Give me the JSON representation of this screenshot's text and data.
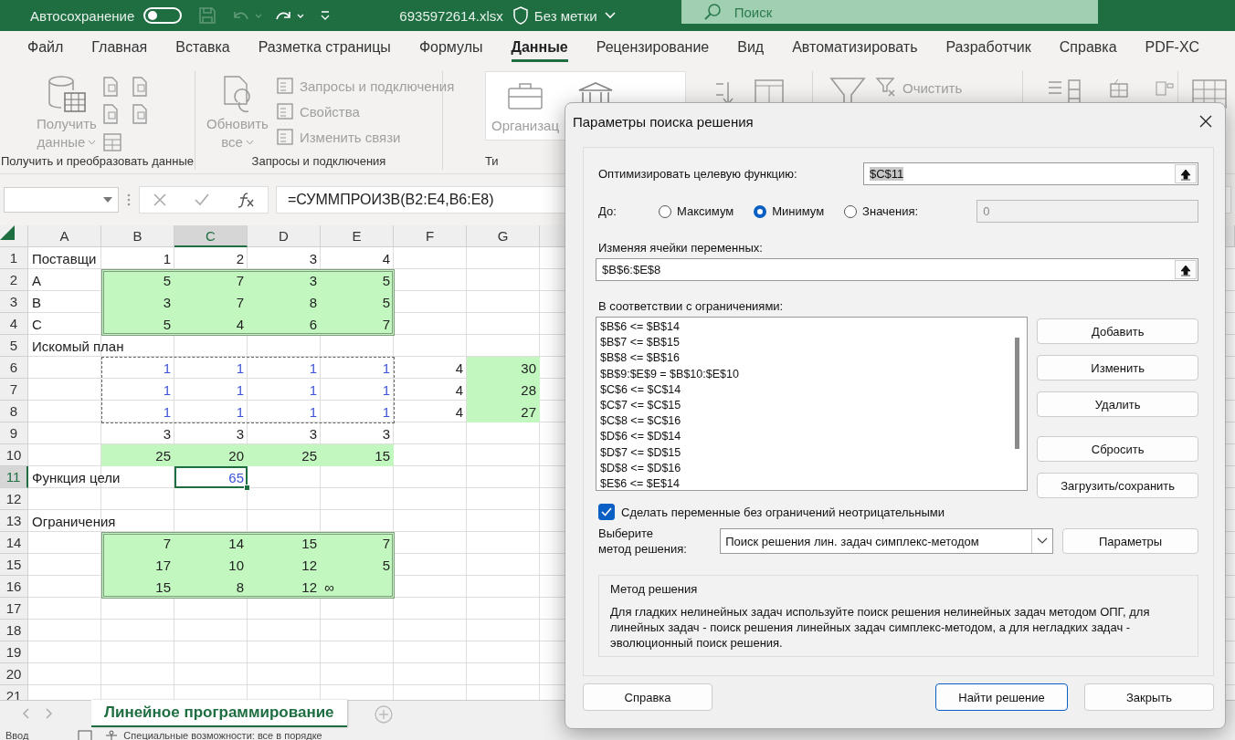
{
  "titlebar": {
    "autosave_label": "Автосохранение",
    "autosave_on": false,
    "filename": "6935972614.xlsx",
    "sensitivity": "Без метки",
    "search_placeholder": "Поиск"
  },
  "menu_tabs": [
    {
      "label": "Файл",
      "selected": false
    },
    {
      "label": "Главная",
      "selected": false
    },
    {
      "label": "Вставка",
      "selected": false
    },
    {
      "label": "Разметка страницы",
      "selected": false
    },
    {
      "label": "Формулы",
      "selected": false
    },
    {
      "label": "Данные",
      "selected": true
    },
    {
      "label": "Рецензирование",
      "selected": false
    },
    {
      "label": "Вид",
      "selected": false
    },
    {
      "label": "Автоматизировать",
      "selected": false
    },
    {
      "label": "Разработчик",
      "selected": false
    },
    {
      "label": "Справка",
      "selected": false
    },
    {
      "label": "PDF-XC",
      "selected": false
    }
  ],
  "ribbon": {
    "get_data": {
      "label": "Получить и преобразовать данные",
      "button_lines": [
        "Получить",
        "данные"
      ],
      "disabled": true
    },
    "queries": {
      "label": "Запросы и подключения",
      "button_lines": [
        "Обновить",
        "все"
      ],
      "disabled": true,
      "small": [
        {
          "label": "Запросы и подключения",
          "disabled": true
        },
        {
          "label": "Свойства",
          "disabled": true
        },
        {
          "label": "Изменить связи",
          "disabled": true
        }
      ]
    },
    "types": {
      "label": "Ти",
      "item": "Организац"
    },
    "filter": {
      "clear": "Очистить",
      "disabled": true
    }
  },
  "formula_bar": {
    "formula": "=СУММПРОИЗВ(B2:E4,B6:E8)"
  },
  "grid": {
    "columns": [
      {
        "label": "A",
        "selected": false
      },
      {
        "label": "B",
        "selected": false
      },
      {
        "label": "C",
        "selected": true
      },
      {
        "label": "D",
        "selected": false
      },
      {
        "label": "E",
        "selected": false
      },
      {
        "label": "F",
        "selected": false
      },
      {
        "label": "G",
        "selected": false
      }
    ],
    "rows": [
      {
        "label": "1",
        "selected": false,
        "cells": [
          {
            "text": "Поставщи",
            "kind": "label",
            "filled": false,
            "selected": false
          },
          {
            "text": "1",
            "kind": "number",
            "filled": false,
            "selected": false
          },
          {
            "text": "2",
            "kind": "number",
            "filled": false,
            "selected": false
          },
          {
            "text": "3",
            "kind": "number",
            "filled": false,
            "selected": false
          },
          {
            "text": "4",
            "kind": "number",
            "filled": false,
            "selected": false
          }
        ]
      },
      {
        "label": "2",
        "selected": false,
        "cells": [
          {
            "text": "A",
            "kind": "label",
            "filled": false,
            "selected": false
          },
          {
            "text": "5",
            "kind": "number",
            "filled": true,
            "selected": false
          },
          {
            "text": "7",
            "kind": "number",
            "filled": true,
            "selected": false
          },
          {
            "text": "3",
            "kind": "number",
            "filled": true,
            "selected": false
          },
          {
            "text": "5",
            "kind": "number",
            "filled": true,
            "selected": false
          }
        ]
      },
      {
        "label": "3",
        "selected": false,
        "cells": [
          {
            "text": "B",
            "kind": "label",
            "filled": false,
            "selected": false
          },
          {
            "text": "3",
            "kind": "number",
            "filled": true,
            "selected": false
          },
          {
            "text": "7",
            "kind": "number",
            "filled": true,
            "selected": false
          },
          {
            "text": "8",
            "kind": "number",
            "filled": true,
            "selected": false
          },
          {
            "text": "5",
            "kind": "number",
            "filled": true,
            "selected": false
          }
        ]
      },
      {
        "label": "4",
        "selected": false,
        "cells": [
          {
            "text": "C",
            "kind": "label",
            "filled": false,
            "selected": false
          },
          {
            "text": "5",
            "kind": "number",
            "filled": true,
            "selected": false
          },
          {
            "text": "4",
            "kind": "number",
            "filled": true,
            "selected": false
          },
          {
            "text": "6",
            "kind": "number",
            "filled": true,
            "selected": false
          },
          {
            "text": "7",
            "kind": "number",
            "filled": true,
            "selected": false
          }
        ]
      },
      {
        "label": "5",
        "selected": false,
        "cells": [
          {
            "text": "Искомый план",
            "kind": "label",
            "filled": false,
            "selected": false
          }
        ]
      },
      {
        "label": "6",
        "selected": false,
        "cells": [
          null,
          {
            "text": "1",
            "kind": "variable",
            "filled": false,
            "selected": false
          },
          {
            "text": "1",
            "kind": "variable",
            "filled": false,
            "selected": false
          },
          {
            "text": "1",
            "kind": "variable",
            "filled": false,
            "selected": false
          },
          {
            "text": "1",
            "kind": "variable",
            "filled": false,
            "selected": false
          },
          {
            "text": "4",
            "kind": "number",
            "filled": false,
            "selected": false
          },
          {
            "text": "30",
            "kind": "number",
            "filled": true,
            "selected": false
          }
        ]
      },
      {
        "label": "7",
        "selected": false,
        "cells": [
          null,
          {
            "text": "1",
            "kind": "variable",
            "filled": false,
            "selected": false
          },
          {
            "text": "1",
            "kind": "variable",
            "filled": false,
            "selected": false
          },
          {
            "text": "1",
            "kind": "variable",
            "filled": false,
            "selected": false
          },
          {
            "text": "1",
            "kind": "variable",
            "filled": false,
            "selected": false
          },
          {
            "text": "4",
            "kind": "number",
            "filled": false,
            "selected": false
          },
          {
            "text": "28",
            "kind": "number",
            "filled": true,
            "selected": false
          }
        ]
      },
      {
        "label": "8",
        "selected": false,
        "cells": [
          null,
          {
            "text": "1",
            "kind": "variable",
            "filled": false,
            "selected": false
          },
          {
            "text": "1",
            "kind": "variable",
            "filled": false,
            "selected": false
          },
          {
            "text": "1",
            "kind": "variable",
            "filled": false,
            "selected": false
          },
          {
            "text": "1",
            "kind": "variable",
            "filled": false,
            "selected": false
          },
          {
            "text": "4",
            "kind": "number",
            "filled": false,
            "selected": false
          },
          {
            "text": "27",
            "kind": "number",
            "filled": true,
            "selected": false
          }
        ]
      },
      {
        "label": "9",
        "selected": false,
        "cells": [
          null,
          {
            "text": "3",
            "kind": "number",
            "filled": false,
            "selected": false
          },
          {
            "text": "3",
            "kind": "number",
            "filled": false,
            "selected": false
          },
          {
            "text": "3",
            "kind": "number",
            "filled": false,
            "selected": false
          },
          {
            "text": "3",
            "kind": "number",
            "filled": false,
            "selected": false
          }
        ]
      },
      {
        "label": "10",
        "selected": false,
        "cells": [
          null,
          {
            "text": "25",
            "kind": "number",
            "filled": true,
            "selected": false
          },
          {
            "text": "20",
            "kind": "number",
            "filled": true,
            "selected": false
          },
          {
            "text": "25",
            "kind": "number",
            "filled": true,
            "selected": false
          },
          {
            "text": "15",
            "kind": "number",
            "filled": true,
            "selected": false
          }
        ]
      },
      {
        "label": "11",
        "selected": true,
        "cells": [
          {
            "text": "Функция цели",
            "kind": "label",
            "filled": false,
            "selected": false
          },
          null,
          {
            "text": "65",
            "kind": "variable",
            "filled": false,
            "selected": true
          }
        ]
      },
      {
        "label": "12",
        "selected": false,
        "cells": []
      },
      {
        "label": "13",
        "selected": false,
        "cells": [
          {
            "text": "Ограничения",
            "kind": "label",
            "filled": false,
            "selected": false
          }
        ]
      },
      {
        "label": "14",
        "selected": false,
        "cells": [
          null,
          {
            "text": "7",
            "kind": "number",
            "filled": true,
            "selected": false
          },
          {
            "text": "14",
            "kind": "number",
            "filled": true,
            "selected": false
          },
          {
            "text": "15",
            "kind": "number",
            "filled": true,
            "selected": false
          },
          {
            "text": "7",
            "kind": "number",
            "filled": true,
            "selected": false
          }
        ]
      },
      {
        "label": "15",
        "selected": false,
        "cells": [
          null,
          {
            "text": "17",
            "kind": "number",
            "filled": true,
            "selected": false
          },
          {
            "text": "10",
            "kind": "number",
            "filled": true,
            "selected": false
          },
          {
            "text": "12",
            "kind": "number",
            "filled": true,
            "selected": false
          },
          {
            "text": "5",
            "kind": "number",
            "filled": true,
            "selected": false
          }
        ]
      },
      {
        "label": "16",
        "selected": false,
        "cells": [
          null,
          {
            "text": "15",
            "kind": "number",
            "filled": true,
            "selected": false
          },
          {
            "text": "8",
            "kind": "number",
            "filled": true,
            "selected": false
          },
          {
            "text": "12",
            "kind": "number",
            "filled": true,
            "selected": false
          },
          {
            "text": "∞",
            "kind": "label",
            "filled": true,
            "selected": false
          }
        ]
      },
      {
        "label": "17",
        "selected": false,
        "cells": []
      },
      {
        "label": "18",
        "selected": false,
        "cells": []
      },
      {
        "label": "19",
        "selected": false,
        "cells": []
      },
      {
        "label": "20",
        "selected": false,
        "cells": []
      },
      {
        "label": "21",
        "selected": false,
        "cells": []
      }
    ]
  },
  "sheet_tabs": [
    {
      "label": "Линейное программирование",
      "selected": true
    }
  ],
  "status_bar": {
    "mode": "Ввод",
    "accessibility": "Специальные возможности: все в порядке"
  },
  "dialog": {
    "title": "Параметры поиска решения",
    "objective_label": "Оптимизировать целевую функцию:",
    "objective_value": "$C$11",
    "to_label": "До:",
    "options": [
      {
        "label": "Максимум",
        "selected": false
      },
      {
        "label": "Минимум",
        "selected": true
      },
      {
        "label": "Значения:",
        "selected": false
      }
    ],
    "value_field": "0",
    "variables_label": "Изменяя ячейки переменных:",
    "variables_value": "$B$6:$E$8",
    "constraints_label": "В соответствии с ограничениями:",
    "constraints": [
      "$B$6 <= $B$14",
      "$B$7 <= $B$15",
      "$B$8 <= $B$16",
      "$B$9:$E$9 = $B$10:$E$10",
      "$C$6 <= $C$14",
      "$C$7 <= $C$15",
      "$C$8 <= $C$16",
      "$D$6 <= $D$14",
      "$D$7 <= $D$15",
      "$D$8 <= $D$16",
      "$E$6 <= $E$14"
    ],
    "side_buttons": [
      "Добавить",
      "Изменить",
      "Удалить",
      "Сбросить",
      "Загрузить/сохранить"
    ],
    "nonnegative": {
      "label": "Сделать переменные без ограничений неотрицательными",
      "checked": true
    },
    "method_label": [
      "Выберите",
      "метод решения:"
    ],
    "method_value": "Поиск решения лин. задач симплекс-методом",
    "params_button": "Параметры",
    "method_group": {
      "title": "Метод решения",
      "text": "Для гладких нелинейных задач используйте поиск решения нелинейных задач методом ОПГ, для линейных задач - поиск решения линейных задач симплекс-методом, а для негладких задач - эволюционный поиск решения."
    },
    "buttons": [
      {
        "label": "Справка",
        "default": false
      },
      {
        "label": "Найти решение",
        "default": true
      },
      {
        "label": "Закрыть",
        "default": false
      }
    ]
  }
}
